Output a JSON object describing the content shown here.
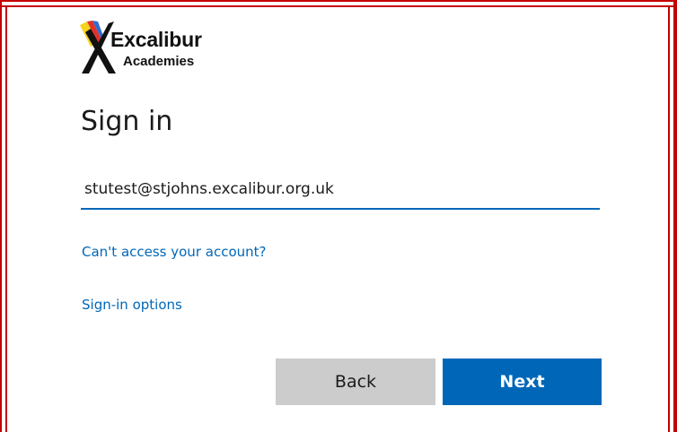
{
  "logo": {
    "name": "Excalibur",
    "subtitle": "Academies",
    "icon": "excalibur-sword-x-logo"
  },
  "signin": {
    "title": "Sign in",
    "email_value": "stutest@stjohns.excalibur.org.uk",
    "links": {
      "cant_access": "Can't access your account?",
      "options": "Sign-in options"
    },
    "buttons": {
      "back": "Back",
      "next": "Next"
    }
  },
  "colors": {
    "accent": "#0067b8",
    "frame": "#c40000",
    "back_button": "#cccccc"
  }
}
